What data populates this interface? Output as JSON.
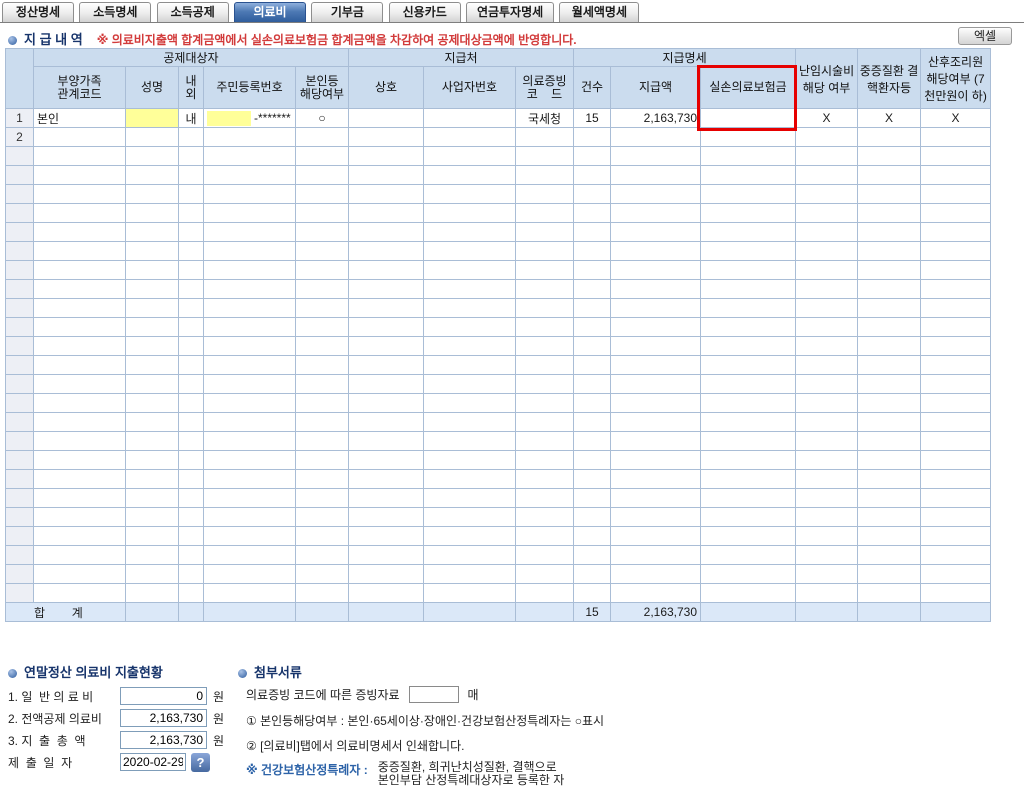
{
  "tabs": [
    {
      "label": "정산명세",
      "active": false
    },
    {
      "label": "소득명세",
      "active": false
    },
    {
      "label": "소득공제",
      "active": false
    },
    {
      "label": "의료비",
      "active": true
    },
    {
      "label": "기부금",
      "active": false
    },
    {
      "label": "신용카드",
      "active": false
    },
    {
      "label": "연금투자명세",
      "active": false
    },
    {
      "label": "월세액명세",
      "active": false
    }
  ],
  "toolbar": {
    "excel_button": "엑셀"
  },
  "section": {
    "title": "지 급 내 역",
    "notice": "※ 의료비지출액 합계금액에서 실손의료보험금 합계금액을 차감하여 공제대상금액에 반영합니다."
  },
  "table": {
    "groups": {
      "deduction_target": "공제대상자",
      "payer": "지급처",
      "payment_detail": "지급명세"
    },
    "columns": {
      "relation": "부양가족\n관계코드",
      "name": "성명",
      "nae_oe": "내\n외",
      "rrn": "주민등록번호",
      "self_yn": "본인등\n해당여부",
      "company": "상호",
      "business_no": "사업자번호",
      "evidence_code": "의료증빙\n코    드",
      "count": "건수",
      "amount": "지급액",
      "insurance": "실손의료보험금",
      "infertility": "난임시술비\n해당 여부",
      "severe": "중증질환\n결핵환자등",
      "postnatal": "산후조리원\n해당여부\n(7천만원이\n하)"
    },
    "rows": [
      {
        "num": "1",
        "relation": "본인",
        "name": "",
        "nae_oe": "내",
        "rrn_masked": "-*******",
        "self_yn": "○",
        "company": "",
        "business_no": "",
        "evidence_code": "국세청",
        "count": "15",
        "amount": "2,163,730",
        "insurance": "",
        "infertility": "X",
        "severe": "X",
        "postnatal": "X"
      },
      {
        "num": "2",
        "relation": "",
        "name": "",
        "nae_oe": "",
        "rrn_masked": "",
        "self_yn": "",
        "company": "",
        "business_no": "",
        "evidence_code": "",
        "count": "",
        "amount": "",
        "insurance": "",
        "infertility": "",
        "severe": "",
        "postnatal": ""
      }
    ],
    "empty_row_count": 24,
    "total_row": {
      "label": "합        계",
      "count": "15",
      "amount": "2,163,730"
    }
  },
  "summary": {
    "title": "연말정산 의료비 지출현황",
    "items": [
      {
        "label": "1. 일  반 의 료 비",
        "value": "0",
        "unit": "원"
      },
      {
        "label": "2. 전액공제 의료비",
        "value": "2,163,730",
        "unit": "원"
      },
      {
        "label": "3. 지  출  총  액",
        "value": "2,163,730",
        "unit": "원"
      }
    ],
    "submit_date_label": "제  출  일  자",
    "submit_date_value": "2020-02-29",
    "help_button": "?"
  },
  "attachments": {
    "title": "첨부서류",
    "evidence_line_prefix": "의료증빙 코드에 따른 증빙자료",
    "evidence_count_value": "",
    "evidence_line_suffix": "매",
    "note1": "① 본인등해당여부 : 본인·65세이상·장애인·건강보험산정특례자는 ○표시",
    "note2": "② [의료비]탭에서 의료비명세서 인쇄합니다.",
    "special_label": "※ 건강보험산정특례자 :",
    "special_desc_line1": "중증질환, 희귀난치성질환, 결핵으로",
    "special_desc_line2": "본인부담 산정특례대상자로 등록한 자"
  },
  "colors": {
    "active_tab": "#3f6cab",
    "header_bg": "#cbdcee",
    "grid_border": "#a9bdd6",
    "highlight_yellow": "#ffff99",
    "alert_red_box": "#e60000",
    "notice_red": "#d23b3b",
    "title_navy": "#17346b",
    "link_blue": "#2d63a8",
    "total_row_bg": "#dbe8f8"
  }
}
